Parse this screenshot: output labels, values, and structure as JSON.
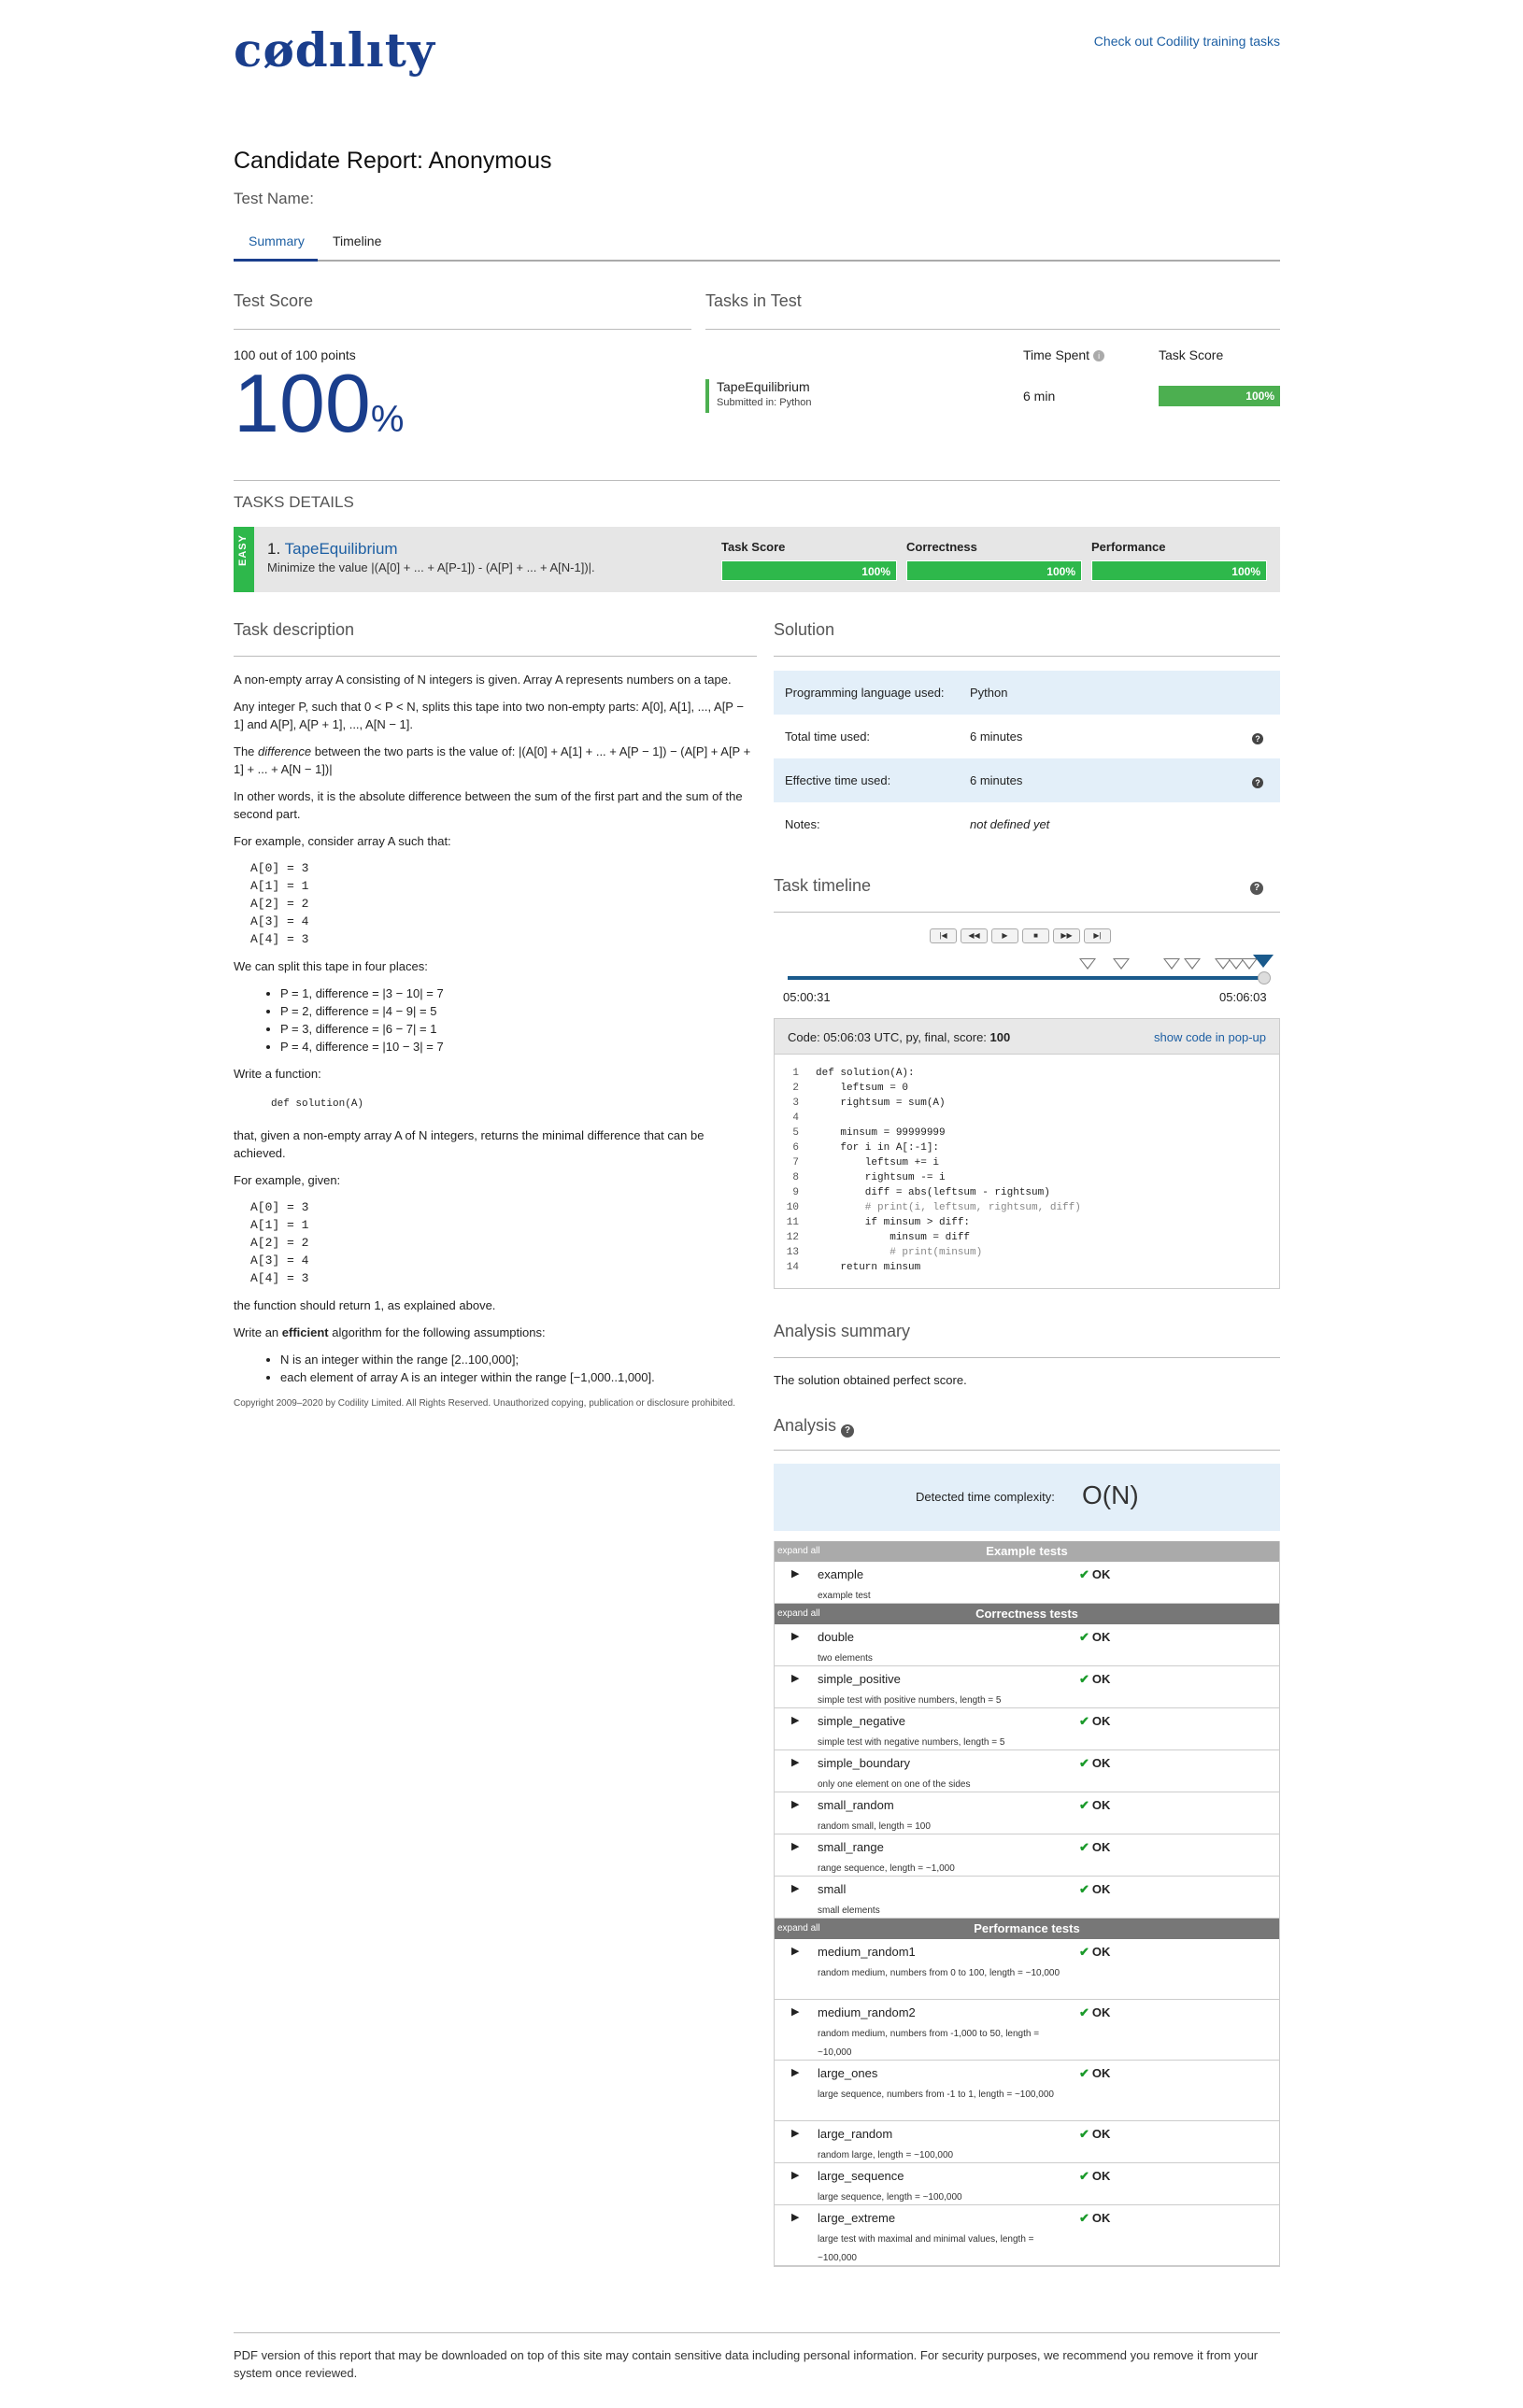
{
  "header": {
    "logo": "cødılıty",
    "training_link": "Check out Codility training tasks"
  },
  "report": {
    "title": "Candidate Report: Anonymous",
    "test_name_label": "Test Name:"
  },
  "tabs": [
    {
      "label": "Summary"
    },
    {
      "label": "Timeline"
    }
  ],
  "score": {
    "heading": "Test Score",
    "points": "100 out of 100 points",
    "big": "100",
    "pct": "%"
  },
  "tasks_in_test": {
    "heading": "Tasks in Test",
    "time_spent_label": "Time Spent",
    "task_score_label": "Task Score",
    "task_name": "TapeEquilibrium",
    "submitted": "Submitted in: Python",
    "time_spent": "6 min",
    "task_score": "100%"
  },
  "task_details": {
    "heading": "TASKS DETAILS",
    "difficulty": "EASY",
    "number": "1.",
    "name": "TapeEquilibrium",
    "summary": "Minimize the value |(A[0] + ... + A[P-1]) - (A[P] + ... + A[N-1])|.",
    "task_score_label": "Task Score",
    "correctness_label": "Correctness",
    "performance_label": "Performance",
    "task_score": "100%",
    "correctness": "100%",
    "performance": "100%"
  },
  "description": {
    "heading": "Task description",
    "p1": "A non-empty array A consisting of N integers is given. Array A represents numbers on a tape.",
    "p2": "Any integer P, such that 0 < P < N, splits this tape into two non-empty parts: A[0], A[1], ..., A[P − 1] and A[P], A[P + 1], ..., A[N − 1].",
    "p3_pre": "The ",
    "p3_em": "difference",
    "p3_post": " between the two parts is the value of: |(A[0] + A[1] + ... + A[P − 1]) − (A[P] + A[P + 1] + ... + A[N − 1])|",
    "p4": "In other words, it is the absolute difference between the sum of the first part and the sum of the second part.",
    "p5": "For example, consider array A such that:",
    "array1": "A[0] = 3\nA[1] = 1\nA[2] = 2\nA[3] = 4\nA[4] = 3",
    "p6": "We can split this tape in four places:",
    "splits": [
      "P = 1, difference = |3 − 10| = 7",
      "P = 2, difference = |4 − 9| = 5",
      "P = 3, difference = |6 − 7| = 1",
      "P = 4, difference = |10 − 3| = 7"
    ],
    "p7": "Write a function:",
    "signature": "def solution(A)",
    "p8": "that, given a non-empty array A of N integers, returns the minimal difference that can be achieved.",
    "p9": "For example, given:",
    "array2": "A[0] = 3\nA[1] = 1\nA[2] = 2\nA[3] = 4\nA[4] = 3",
    "p10": "the function should return 1, as explained above.",
    "p11_pre": "Write an ",
    "p11_b": "efficient",
    "p11_post": " algorithm for the following assumptions:",
    "assumptions": [
      "N is an integer within the range [2..100,000];",
      "each element of array A is an integer within the range [−1,000..1,000]."
    ],
    "copyright": "Copyright 2009–2020 by Codility Limited. All Rights Reserved. Unauthorized copying, publication or disclosure prohibited."
  },
  "solution": {
    "heading": "Solution",
    "rows": [
      {
        "label": "Programming language used:",
        "value": "Python"
      },
      {
        "label": "Total time used:",
        "value": "6 minutes"
      },
      {
        "label": "Effective time used:",
        "value": "6 minutes"
      },
      {
        "label": "Notes:",
        "value": "not defined yet"
      }
    ],
    "help_glyph": "?"
  },
  "timeline": {
    "heading": "Task timeline",
    "buttons": [
      "|◀",
      "◀◀",
      "▶",
      "■",
      "▶▶",
      "▶|"
    ],
    "start": "05:00:31",
    "end": "05:06:03"
  },
  "code": {
    "header": "Code: 05:06:03 UTC, py, final, score:",
    "score": "100",
    "popup": "show code in pop-up",
    "lines": [
      "def solution(A):",
      "    leftsum = 0",
      "    rightsum = sum(A)",
      "",
      "    minsum = 99999999",
      "    for i in A[:-1]:",
      "        leftsum += i",
      "        rightsum -= i",
      "        diff = abs(leftsum - rightsum)",
      "        # print(i, leftsum, rightsum, diff)",
      "        if minsum > diff:",
      "            minsum = diff",
      "            # print(minsum)",
      "    return minsum"
    ]
  },
  "analysis_summary": {
    "heading": "Analysis summary",
    "text": "The solution obtained perfect score."
  },
  "analysis": {
    "heading": "Analysis",
    "complexity_label": "Detected time complexity:",
    "complexity": "O(N)",
    "expand_all": "expand all",
    "ok": "OK",
    "groups": [
      {
        "name": "Example tests",
        "tests": [
          {
            "name": "example",
            "desc": "example test"
          }
        ]
      },
      {
        "name": "Correctness tests",
        "tests": [
          {
            "name": "double",
            "desc": "two elements"
          },
          {
            "name": "simple_positive",
            "desc": "simple test with positive numbers, length = 5"
          },
          {
            "name": "simple_negative",
            "desc": "simple test with negative numbers, length = 5"
          },
          {
            "name": "simple_boundary",
            "desc": "only one element on one of the sides"
          },
          {
            "name": "small_random",
            "desc": "random small, length = 100"
          },
          {
            "name": "small_range",
            "desc": "range sequence, length = ~1,000"
          },
          {
            "name": "small",
            "desc": "small elements"
          }
        ]
      },
      {
        "name": "Performance tests",
        "tests": [
          {
            "name": "medium_random1",
            "desc": "random medium, numbers from 0 to 100, length = ~10,000"
          },
          {
            "name": "medium_random2",
            "desc": "random medium, numbers from -1,000 to 50, length = ~10,000"
          },
          {
            "name": "large_ones",
            "desc": "large sequence, numbers from -1 to 1, length = ~100,000"
          },
          {
            "name": "large_random",
            "desc": "random large, length = ~100,000"
          },
          {
            "name": "large_sequence",
            "desc": "large sequence, length = ~100,000"
          },
          {
            "name": "large_extreme",
            "desc": "large test with maximal and minimal values, length = ~100,000"
          }
        ]
      }
    ]
  },
  "footer": {
    "text": "PDF version of this report that may be downloaded on top of this site may contain sensitive data including personal information. For security purposes, we recommend you remove it from your system once reviewed."
  }
}
